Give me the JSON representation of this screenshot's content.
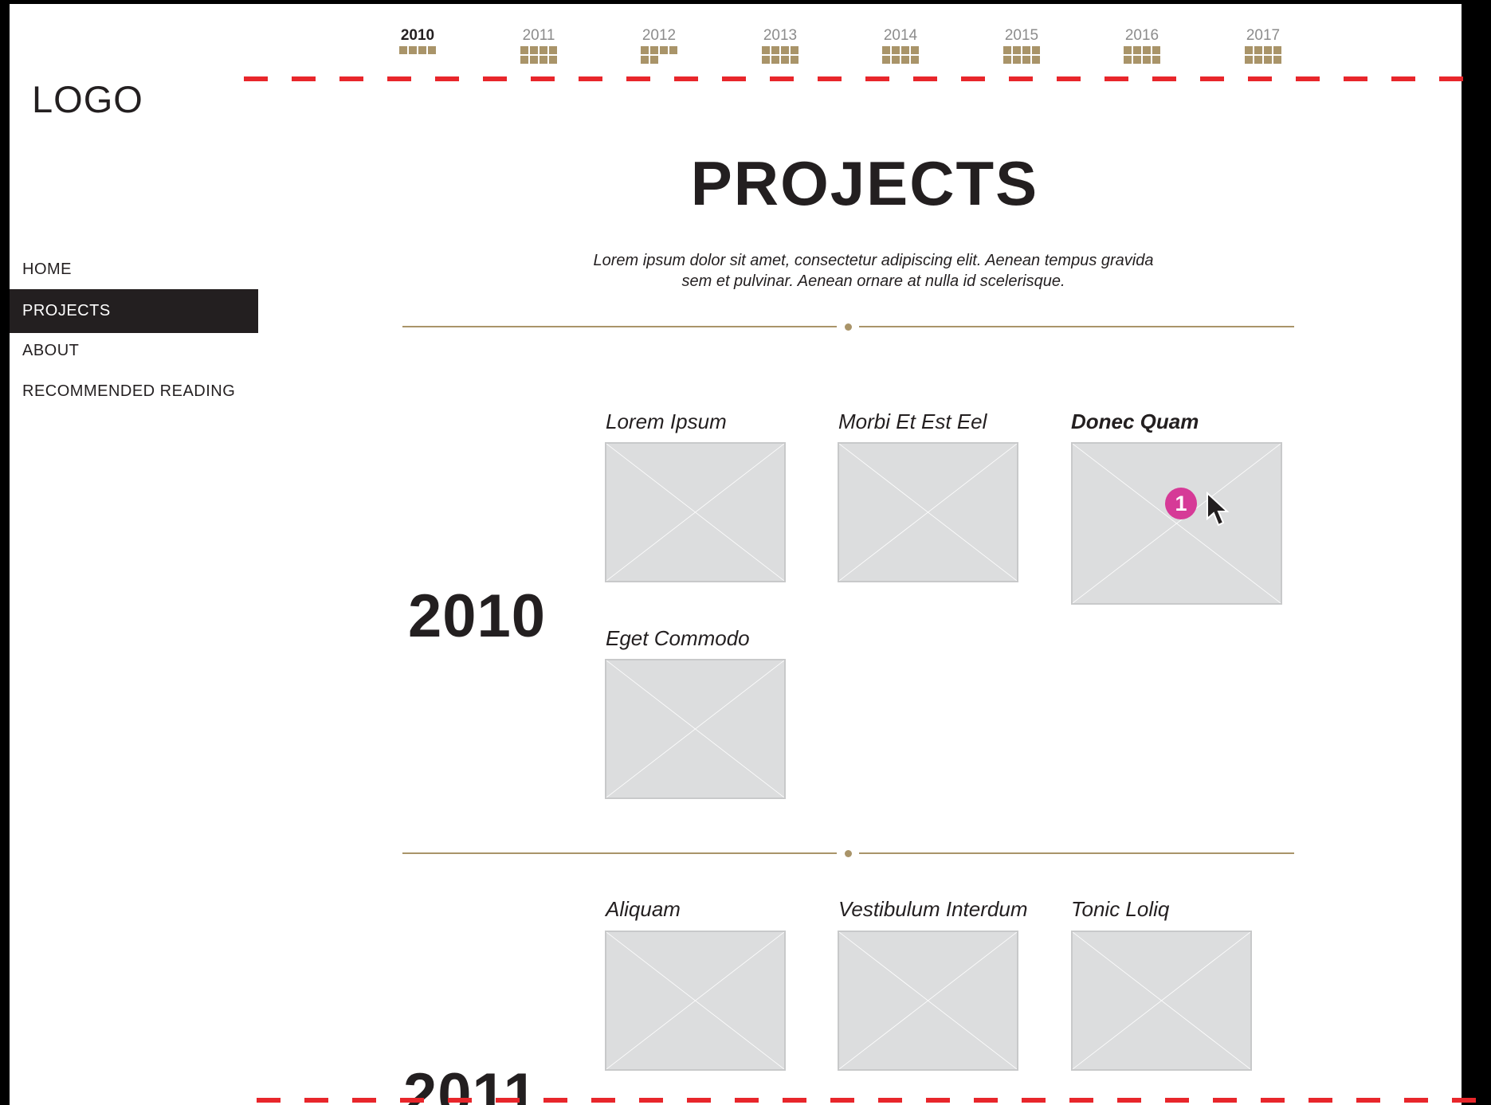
{
  "logo": {
    "text": "LOGO"
  },
  "nav": {
    "items": [
      {
        "label": "HOME"
      },
      {
        "label": "PROJECTS",
        "active": true
      },
      {
        "label": "ABOUT"
      },
      {
        "label": "RECOMMENDED READING"
      }
    ]
  },
  "timeline": {
    "years": [
      "2010",
      "2011",
      "2012",
      "2013",
      "2014",
      "2015",
      "2016",
      "2017"
    ],
    "active": "2010"
  },
  "page": {
    "title": "PROJECTS",
    "subtitle_line1": "Lorem ipsum dolor sit amet, consectetur adipiscing elit. Aenean tempus gravida",
    "subtitle_line2": "sem et pulvinar. Aenean ornare at nulla id scelerisque."
  },
  "sections": [
    {
      "year": "2010",
      "projects": [
        {
          "title": "Lorem Ipsum"
        },
        {
          "title": "Morbi Et Est Eel"
        },
        {
          "title": "Donec Quam",
          "hovered": true
        },
        {
          "title": "Eget Commodo"
        }
      ]
    },
    {
      "year": "2011",
      "projects": [
        {
          "title": "Aliquam"
        },
        {
          "title": "Vestibulum Interdum"
        },
        {
          "title": "Tonic Loliq"
        }
      ]
    }
  ],
  "annotation": {
    "badge": "1"
  },
  "colors": {
    "accent": "#a99469",
    "badge": "#d63a97",
    "guide": "#e8262b",
    "dark": "#231f20"
  }
}
